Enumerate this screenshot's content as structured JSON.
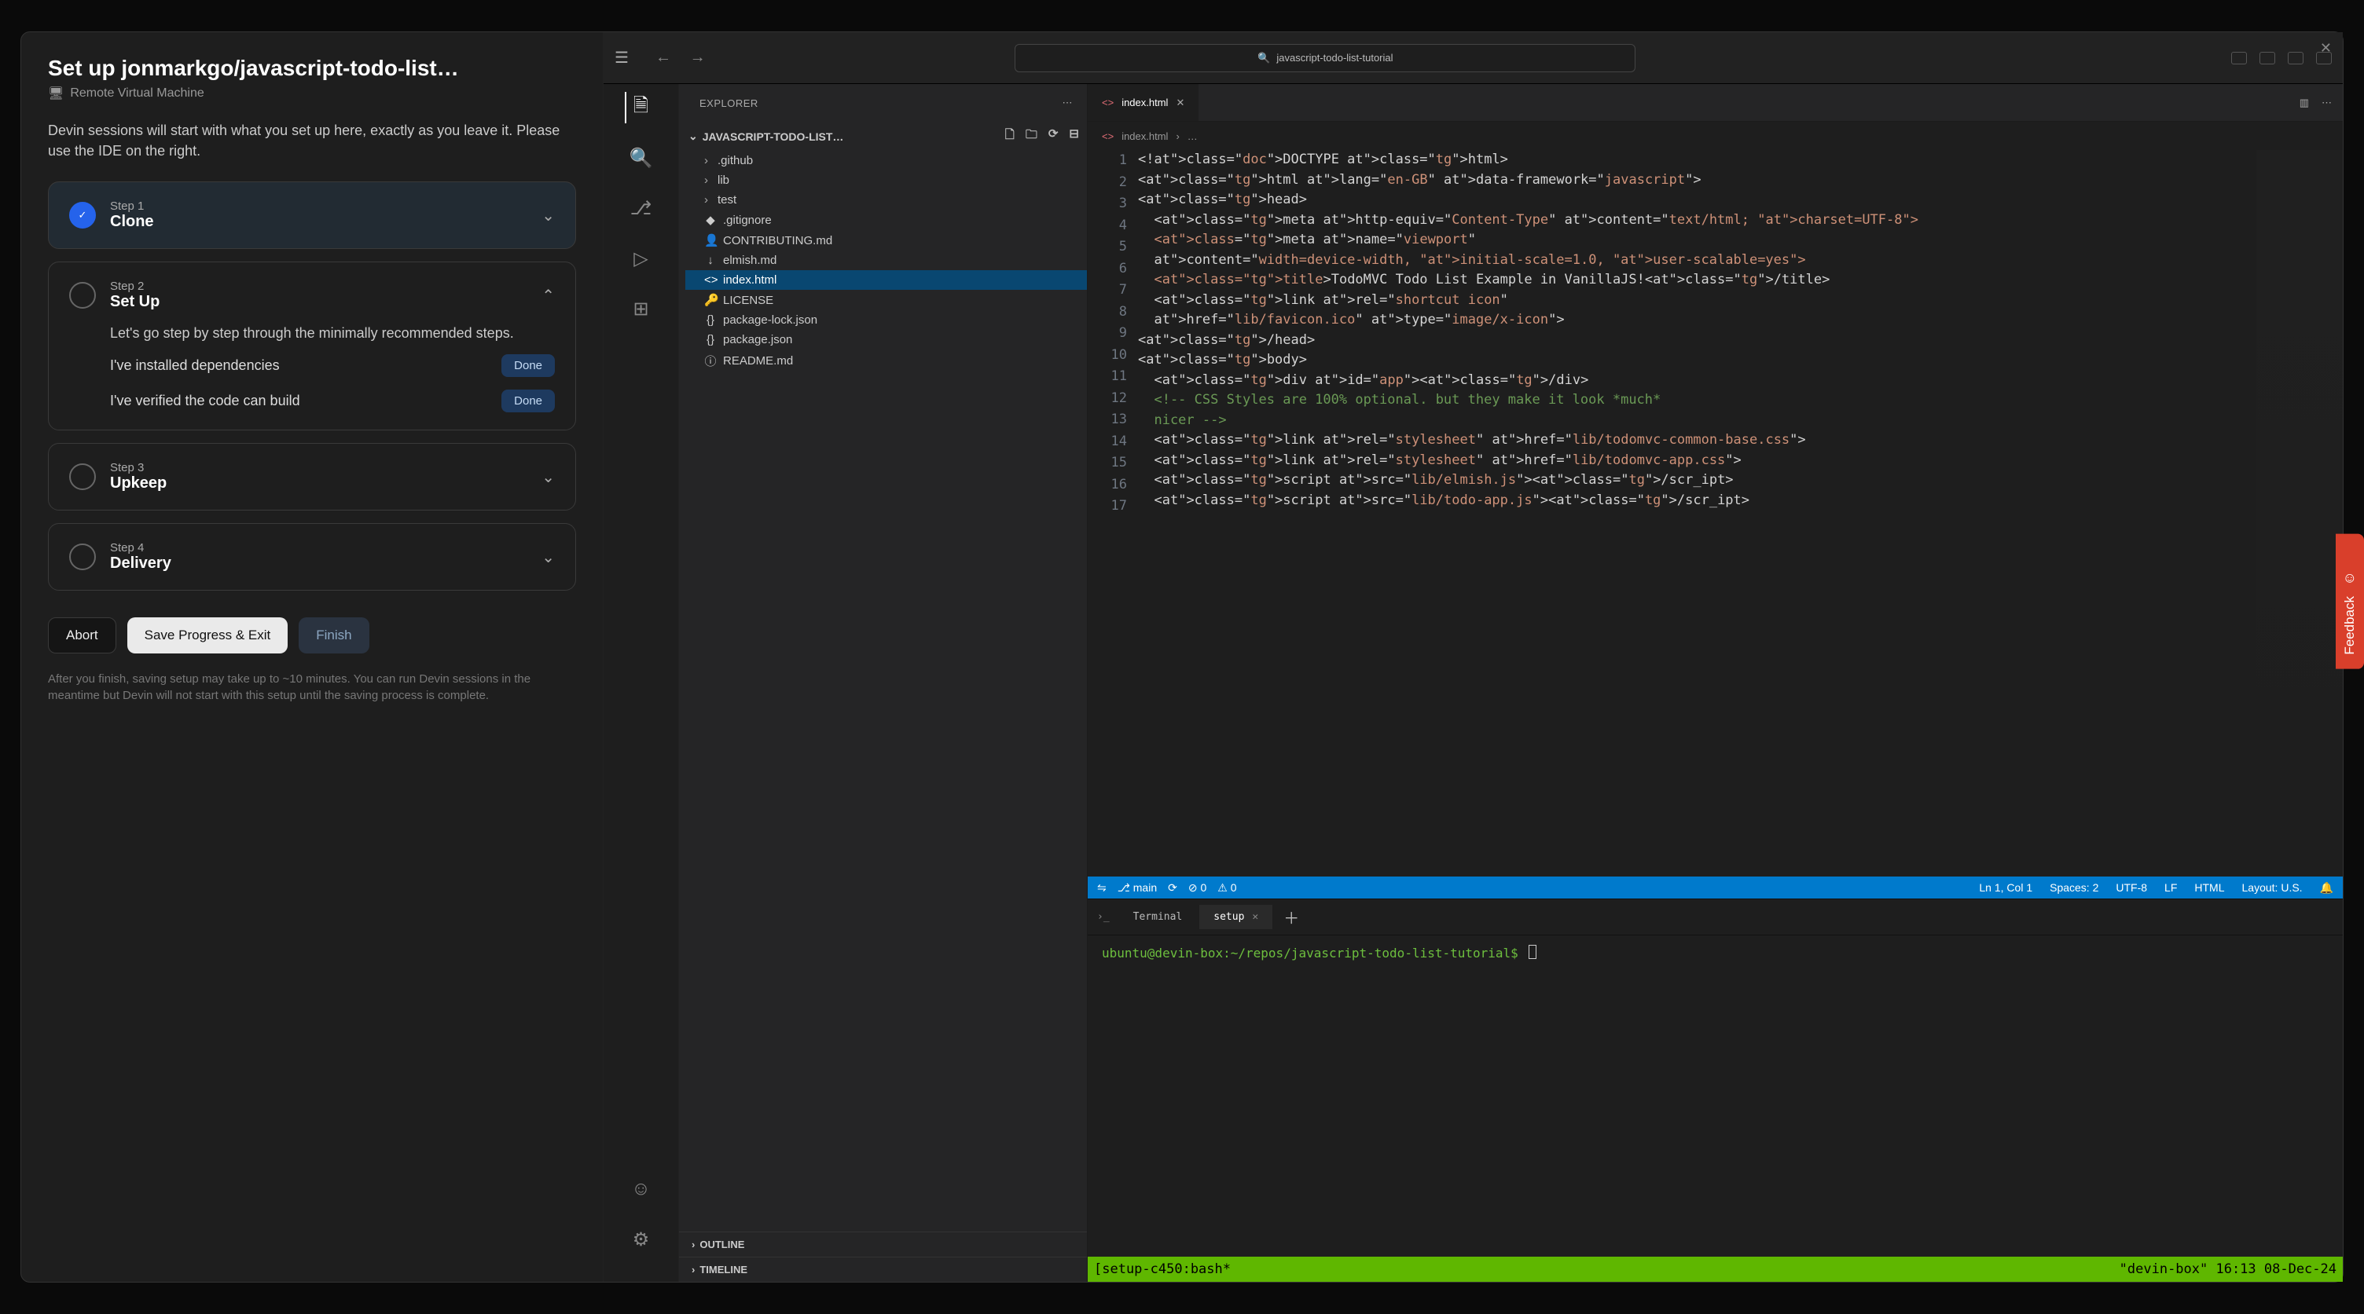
{
  "left": {
    "title": "Set up jonmarkgo/javascript-todo-list…",
    "subtitle": "Remote Virtual Machine",
    "description": "Devin sessions will start with what you set up here, exactly as you leave it. Please use the IDE on the right.",
    "steps": [
      {
        "num": "Step 1",
        "name": "Clone",
        "state": "done"
      },
      {
        "num": "Step 2",
        "name": "Set Up",
        "state": "open",
        "body": "Let's go step by step through the minimally recommended steps.",
        "tasks": [
          {
            "label": "I've installed dependencies",
            "btn": "Done"
          },
          {
            "label": "I've verified the code can build",
            "btn": "Done"
          }
        ]
      },
      {
        "num": "Step 3",
        "name": "Upkeep",
        "state": "closed"
      },
      {
        "num": "Step 4",
        "name": "Delivery",
        "state": "closed"
      }
    ],
    "buttons": {
      "abort": "Abort",
      "save": "Save Progress & Exit",
      "finish": "Finish"
    },
    "footer": "After you finish, saving setup may take up to ~10 minutes. You can run Devin sessions in the meantime but Devin will not start with this setup until the saving process is complete."
  },
  "titlebar": {
    "search_label": "javascript-todo-list-tutorial"
  },
  "sidebar": {
    "title": "EXPLORER",
    "project": "JAVASCRIPT-TODO-LIST…",
    "files": [
      {
        "name": ".github",
        "type": "folder"
      },
      {
        "name": "lib",
        "type": "folder"
      },
      {
        "name": "test",
        "type": "folder"
      },
      {
        "name": ".gitignore",
        "type": "file",
        "ico": "◆"
      },
      {
        "name": "CONTRIBUTING.md",
        "type": "file",
        "ico": "👤"
      },
      {
        "name": "elmish.md",
        "type": "file",
        "ico": "↓"
      },
      {
        "name": "index.html",
        "type": "file",
        "ico": "<>",
        "selected": true
      },
      {
        "name": "LICENSE",
        "type": "file",
        "ico": "🔑"
      },
      {
        "name": "package-lock.json",
        "type": "file",
        "ico": "{}"
      },
      {
        "name": "package.json",
        "type": "file",
        "ico": "{}"
      },
      {
        "name": "README.md",
        "type": "file",
        "ico": "ⓘ"
      }
    ],
    "outline": "OUTLINE",
    "timeline": "TIMELINE"
  },
  "tab": {
    "name": "index.html",
    "ico": "<>"
  },
  "breadcrumb": {
    "file": "index.html",
    "more": "…"
  },
  "code_lines": [
    "<!DOCTYPE html>",
    "<html lang=\"en-GB\" data-framework=\"javascript\">",
    "<head>",
    "  <meta http-equiv=\"Content-Type\" content=\"text/html; charset=UTF-8\">",
    "  <meta name=\"viewport\"",
    "  content=\"width=device-width, initial-scale=1.0, user-scalable=yes\">",
    "  <title>TodoMVC Todo List Example in VanillaJS!</title>",
    "  <link rel=\"shortcut icon\"",
    "  href=\"lib/favicon.ico\" type=\"image/x-icon\">",
    "</head>",
    "<body>",
    "  <div id=\"app\"></div>",
    "  <!-- CSS Styles are 100% optional. but they make it look *much* nicer -->",
    "  <link rel=\"stylesheet\" href=\"lib/todomvc-common-base.css\">",
    "  <link rel=\"stylesheet\" href=\"lib/todomvc-app.css\">",
    "  <script src=\"lib/elmish.js\"></scr_ipt>",
    "  <script src=\"lib/todo-app.js\"></scr_ipt>"
  ],
  "code_line_numbers": [
    "1",
    "2",
    "3",
    "4",
    "5",
    "6",
    "7",
    "8",
    "9",
    "10",
    "11",
    "12",
    "13",
    "14",
    "15",
    "16",
    "17"
  ],
  "statusbar": {
    "branch": "main",
    "errors": "0",
    "warnings": "0",
    "position": "Ln 1, Col 1",
    "spaces": "Spaces: 2",
    "encoding": "UTF-8",
    "eol": "LF",
    "lang": "HTML",
    "layout": "Layout: U.S."
  },
  "terminal": {
    "tabs": [
      {
        "label": "Terminal",
        "active": false
      },
      {
        "label": "setup",
        "active": true
      }
    ],
    "prompt": "ubuntu@devin-box:~/repos/javascript-todo-list-tutorial$",
    "status_left": "[setup-c450:bash*",
    "status_right": "\"devin-box\" 16:13 08-Dec-24"
  },
  "feedback": "Feedback"
}
